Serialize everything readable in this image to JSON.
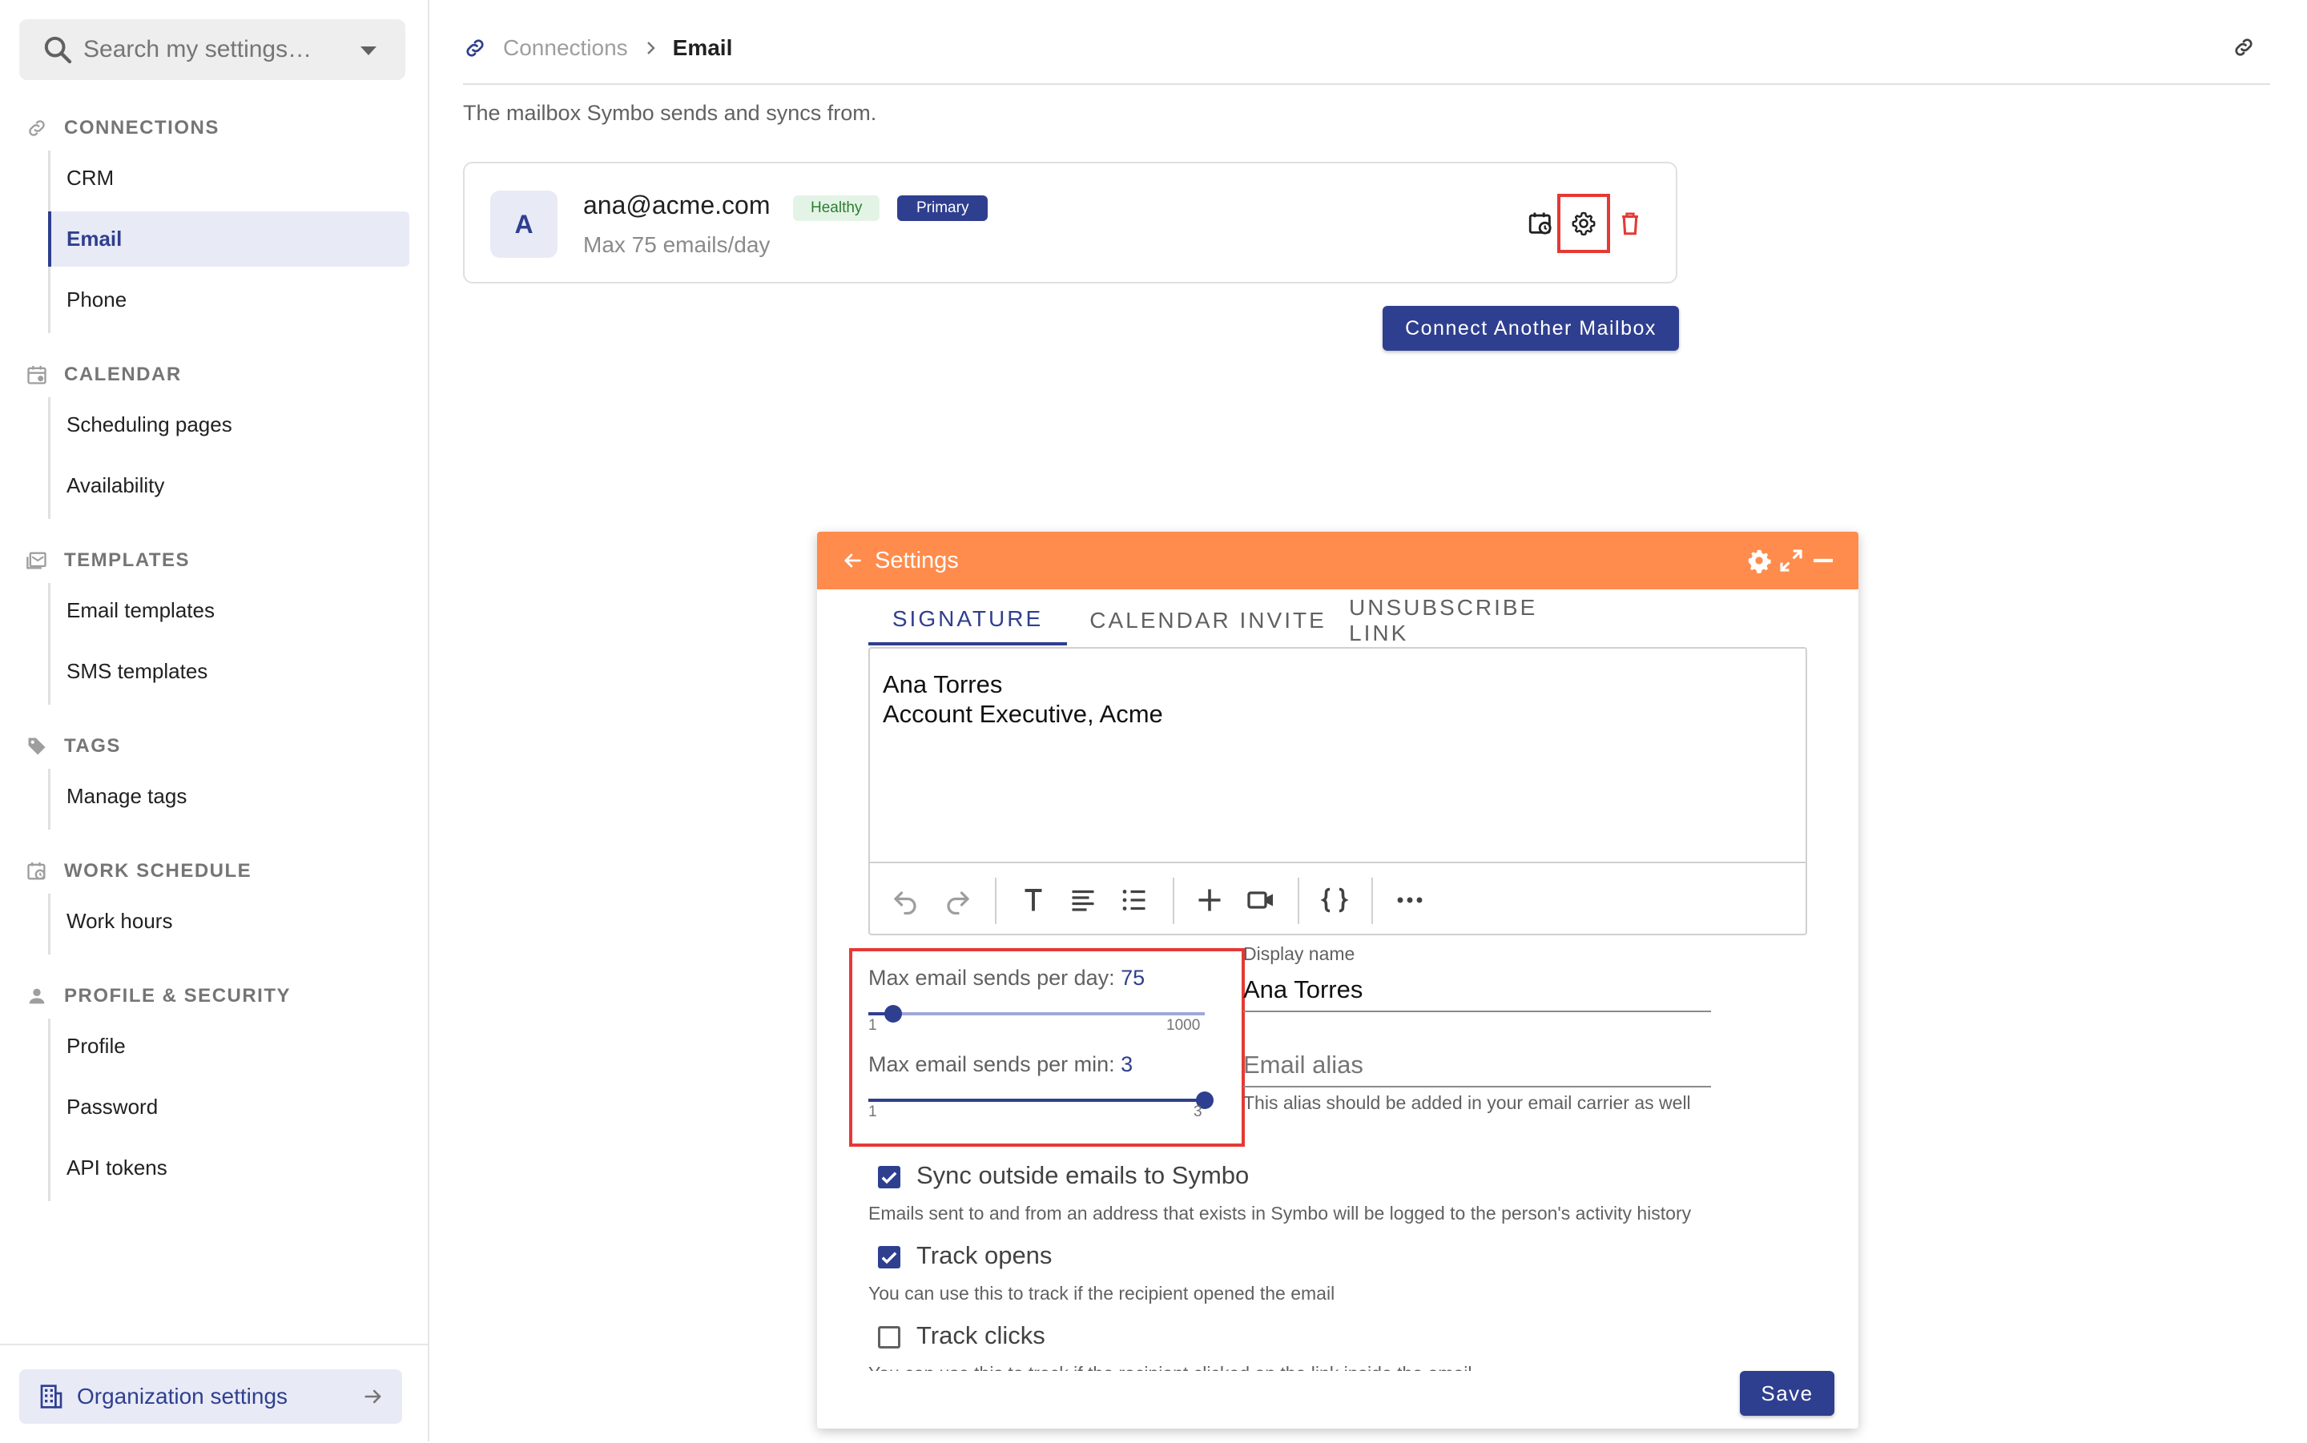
{
  "sidebar": {
    "search_placeholder": "Search my settings…",
    "sections": [
      {
        "title": "CONNECTIONS",
        "icon": "link-icon",
        "items": [
          "CRM",
          "Email",
          "Phone"
        ]
      },
      {
        "title": "CALENDAR",
        "icon": "calendar-icon",
        "items": [
          "Scheduling pages",
          "Availability"
        ]
      },
      {
        "title": "TEMPLATES",
        "icon": "template-icon",
        "items": [
          "Email templates",
          "SMS templates"
        ]
      },
      {
        "title": "TAGS",
        "icon": "tag-icon",
        "items": [
          "Manage tags"
        ]
      },
      {
        "title": "WORK SCHEDULE",
        "icon": "calendar-clock-icon",
        "items": [
          "Work hours"
        ]
      },
      {
        "title": "PROFILE & SECURITY",
        "icon": "person-icon",
        "items": [
          "Profile",
          "Password",
          "API tokens"
        ]
      }
    ],
    "active_item": "Email",
    "footer_label": "Organization settings"
  },
  "header": {
    "breadcrumb_parent": "Connections",
    "breadcrumb_current": "Email",
    "description": "The mailbox Symbo sends and syncs from."
  },
  "mailbox": {
    "avatar_letter": "A",
    "email": "ana@acme.com",
    "health_badge": "Healthy",
    "primary_badge": "Primary",
    "limit_text": "Max 75 emails/day"
  },
  "connect_button": "Connect Another Mailbox",
  "settings_panel": {
    "title": "Settings",
    "tabs": [
      "SIGNATURE",
      "CALENDAR INVITE",
      "UNSUBSCRIBE LINK"
    ],
    "active_tab": "SIGNATURE",
    "signature_text": "Ana Torres\nAccount Executive, Acme",
    "per_day": {
      "label": "Max email sends per day:",
      "value": "75",
      "min": "1",
      "max": "1000",
      "value_num": 75,
      "min_num": 1,
      "max_num": 1000
    },
    "per_min": {
      "label": "Max email sends per min:",
      "value": "3",
      "min": "1",
      "max": "3",
      "value_num": 3,
      "min_num": 1,
      "max_num": 3
    },
    "display_name_label": "Display name",
    "display_name_value": "Ana Torres",
    "email_alias_placeholder": "Email alias",
    "email_alias_help": "This alias should be added in your email carrier as well",
    "sync_label": "Sync outside emails to Symbo",
    "sync_help": "Emails sent to and from an address that exists in Symbo will be logged to the person's activity history",
    "sync_checked": true,
    "track_opens_label": "Track opens",
    "track_opens_help": "You can use this to track if the recipient opened the email",
    "track_opens_checked": true,
    "track_clicks_label": "Track clicks",
    "track_clicks_help": "You can use this to track if the recipient clicked on the link inside the email",
    "track_clicks_checked": false,
    "save_label": "Save"
  },
  "colors": {
    "accent": "#2f3f8f",
    "panel_header": "#ff8c4c",
    "highlight": "#e53935",
    "healthy_bg": "#e3f4e6"
  }
}
